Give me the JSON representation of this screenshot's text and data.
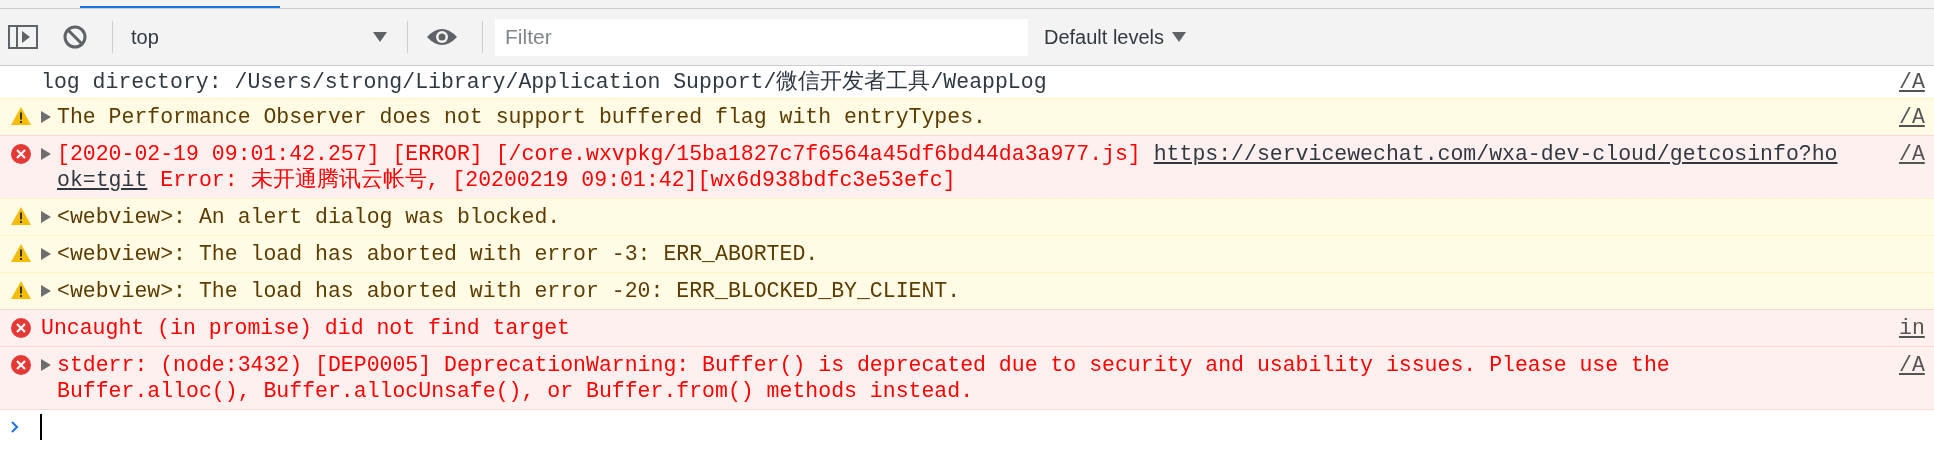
{
  "toolbar": {
    "context": "top",
    "filter": {
      "placeholder": "Filter"
    },
    "levels": "Default levels"
  },
  "messages": [
    {
      "kind": "info",
      "expandable": false,
      "parts": [
        {
          "kind": "text",
          "text": "log directory: /Users/strong/Library/Application Support/微信开发者工具/WeappLog"
        }
      ],
      "source": "/A"
    },
    {
      "kind": "warning",
      "expandable": true,
      "parts": [
        {
          "kind": "text",
          "text": "The Performance Observer does not support buffered flag with entryTypes."
        }
      ],
      "source": "/A"
    },
    {
      "kind": "error",
      "expandable": true,
      "parts": [
        {
          "kind": "text",
          "text": "[2020-02-19 09:01:42.257] [ERROR] [/core.wxvpkg/15ba1827c7f6564a45df6bd44da3a977.js] "
        },
        {
          "kind": "link",
          "text": "https://servicewechat.com/wxa-dev-cloud/getcosinfo?hook=tgit"
        },
        {
          "kind": "text",
          "text": " Error: 未开通腾讯云帐号, [20200219 09:01:42][wx6d938bdfc3e53efc]"
        }
      ],
      "source": "/A"
    },
    {
      "kind": "warning",
      "expandable": true,
      "parts": [
        {
          "kind": "text",
          "text": "<webview>: An alert dialog was blocked."
        }
      ]
    },
    {
      "kind": "warning",
      "expandable": true,
      "parts": [
        {
          "kind": "text",
          "text": "<webview>: The load has aborted with error -3: ERR_ABORTED."
        }
      ]
    },
    {
      "kind": "warning",
      "expandable": true,
      "parts": [
        {
          "kind": "text",
          "text": "<webview>: The load has aborted with error -20: ERR_BLOCKED_BY_CLIENT."
        }
      ]
    },
    {
      "kind": "error",
      "expandable": false,
      "parts": [
        {
          "kind": "text",
          "text": "Uncaught (in promise) did not find target"
        }
      ],
      "source": "in"
    },
    {
      "kind": "error",
      "expandable": true,
      "parts": [
        {
          "kind": "text",
          "text": "stderr: (node:3432) [DEP0005] DeprecationWarning: Buffer() is deprecated due to security and usability issues. Please use the Buffer.alloc(), Buffer.allocUnsafe(), or Buffer.from() methods instead."
        }
      ],
      "source": "/A"
    }
  ]
}
